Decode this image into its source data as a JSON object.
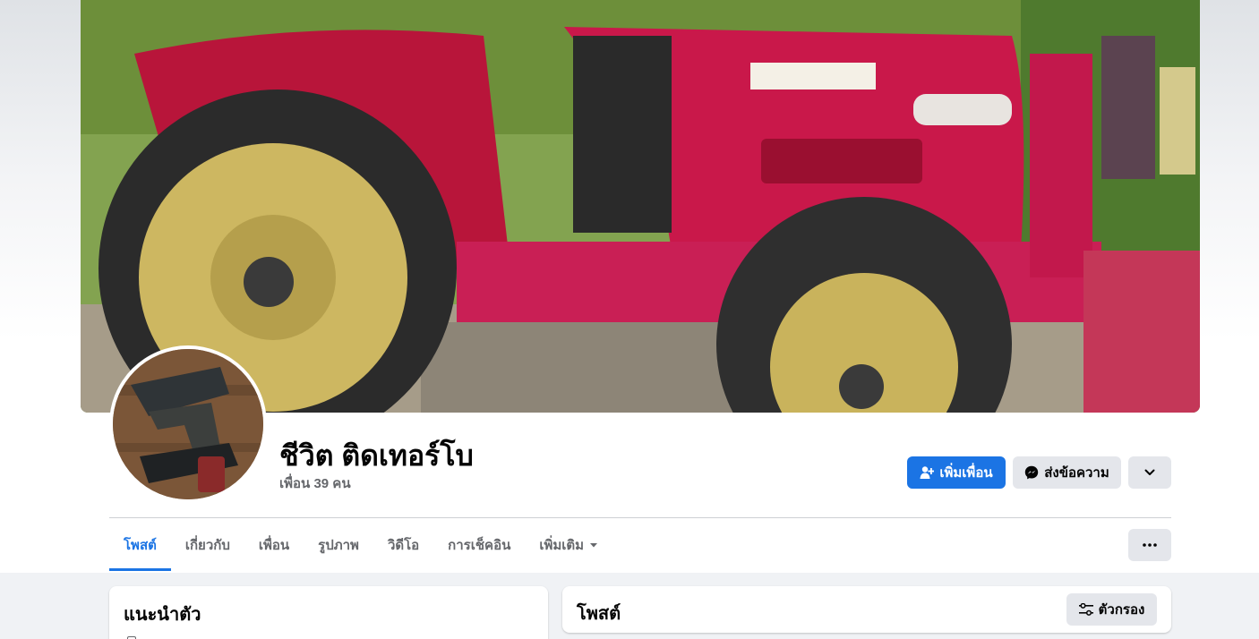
{
  "profile": {
    "name": "ชีวิต ติดเทอร์โบ",
    "friends": "เพื่อน 39 คน"
  },
  "actions": {
    "add_friend": "เพิ่มเพื่อน",
    "message": "ส่งข้อความ"
  },
  "tabs": [
    {
      "label": "โพสต์",
      "active": true
    },
    {
      "label": "เกี่ยวกับ"
    },
    {
      "label": "เพื่อน"
    },
    {
      "label": "รูปภาพ"
    },
    {
      "label": "วิดีโอ"
    },
    {
      "label": "การเช็คอิน"
    },
    {
      "label": "เพิ่มเติม"
    }
  ],
  "intro": {
    "title": "แนะนำตัว"
  },
  "posts": {
    "title": "โพสต์",
    "filter": "ตัวกรอง"
  },
  "colors": {
    "accent": "#1b74e4",
    "secondary_button": "#e4e6eb",
    "page_bg": "#f0f2f5"
  }
}
